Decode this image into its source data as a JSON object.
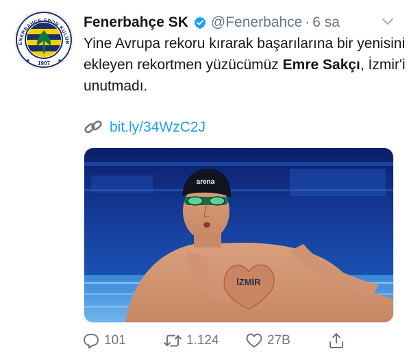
{
  "tweet": {
    "display_name": "Fenerbahçe SK",
    "handle": "@Fenerbahce",
    "separator": "·",
    "time": "6 sa",
    "text_plain_1": "Yine Avrupa rekoru kırarak başarılarına bir yenisini ekleyen rekortmen yüzücümüz ",
    "text_bold": "Emre Sakçı",
    "text_plain_2": ", İzmir'i unutmadı.",
    "link": "bit.ly/34WzC2J"
  },
  "logo": {
    "ring_text": "FENERBAHÇE SPOR KULÜBÜ",
    "year": "1907"
  },
  "media": {
    "cap_text": "arena",
    "arm_text": "İZMİR"
  },
  "actions": {
    "replies": "101",
    "retweets": "1.124",
    "likes": "27B"
  },
  "colors": {
    "accent": "#1da1f2",
    "muted": "#657786",
    "navy": "#1b2d6b",
    "yellow": "#f5d000"
  }
}
